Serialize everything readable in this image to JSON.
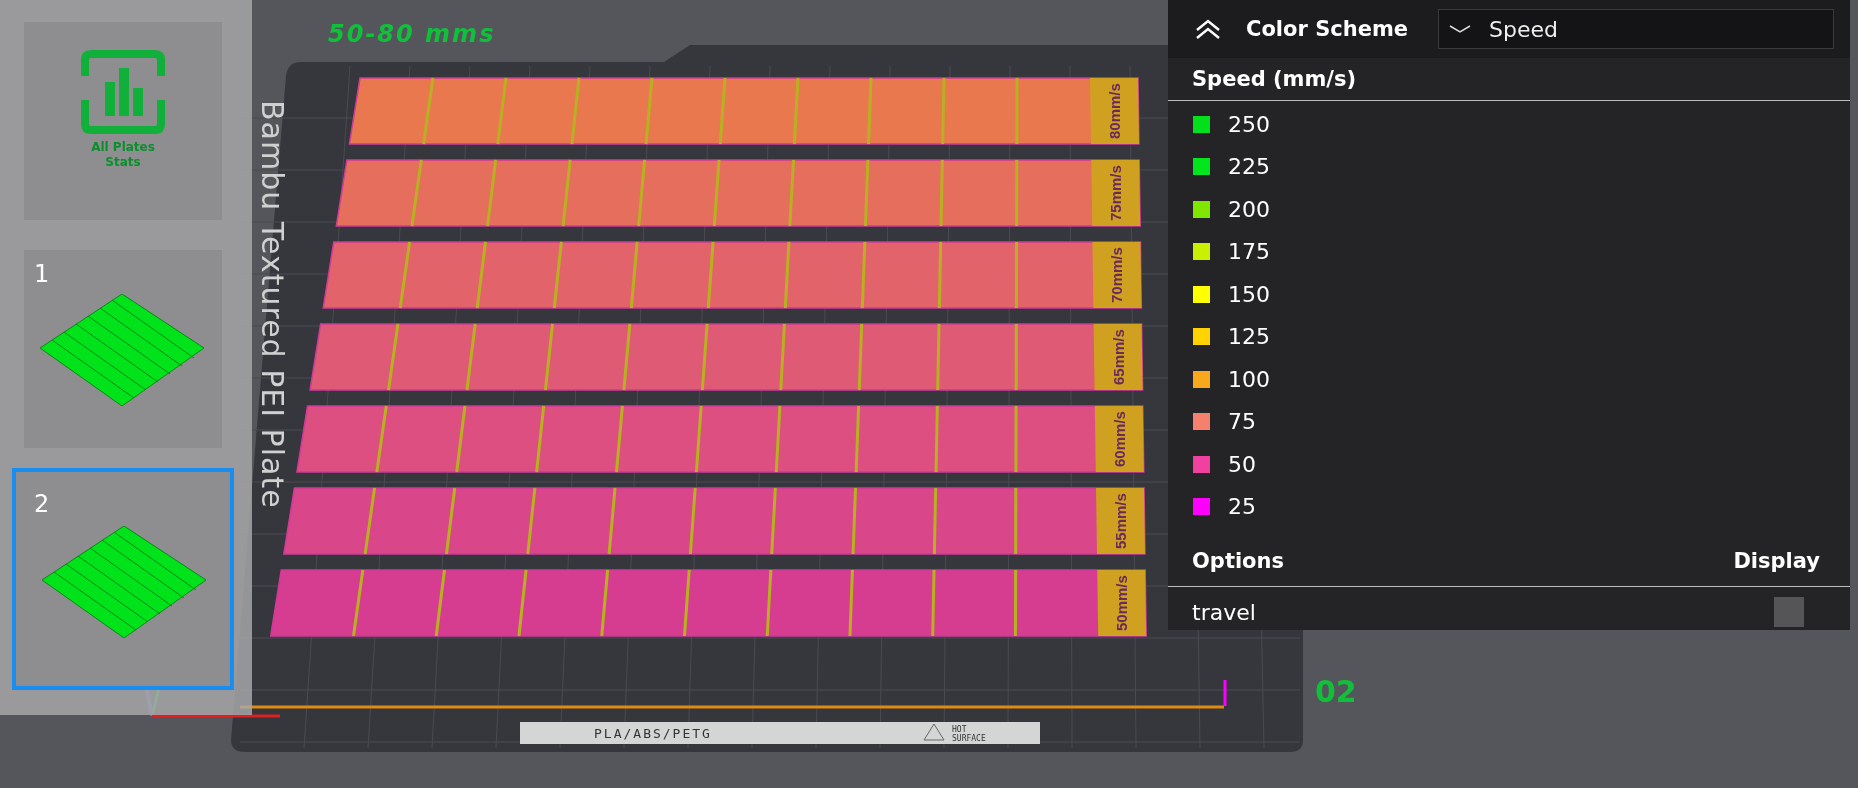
{
  "scene": {
    "title": "50-80 mms",
    "plate_name": "Bambu Textured PEI Plate",
    "plate_number": "02",
    "bed_label": "PLA/ABS/PETG",
    "warning_line_1": "HOT",
    "warning_line_2": "SURFACE",
    "rows": [
      {
        "label": "80mm/s",
        "color": "#e9784e"
      },
      {
        "label": "75mm/s",
        "color": "#e56e5c"
      },
      {
        "label": "70mm/s",
        "color": "#e2646a"
      },
      {
        "label": "65mm/s",
        "color": "#df5a74"
      },
      {
        "label": "60mm/s",
        "color": "#dc4f80"
      },
      {
        "label": "55mm/s",
        "color": "#d9468a"
      },
      {
        "label": "50mm/s",
        "color": "#d63d90"
      }
    ]
  },
  "sidebar": {
    "stats_label": "All Plates Stats",
    "plates": [
      {
        "label": "1",
        "selected": false
      },
      {
        "label": "2",
        "selected": true
      }
    ]
  },
  "panel": {
    "title": "Color Scheme",
    "scheme": "Speed",
    "legend_title": "Speed (mm/s)",
    "legend": [
      {
        "label": "250",
        "color": "#00e11b"
      },
      {
        "label": "225",
        "color": "#00e61c"
      },
      {
        "label": "200",
        "color": "#7fe600"
      },
      {
        "label": "175",
        "color": "#c8f000"
      },
      {
        "label": "150",
        "color": "#ffff00"
      },
      {
        "label": "125",
        "color": "#ffd200"
      },
      {
        "label": "100",
        "color": "#f7a81c"
      },
      {
        "label": "75",
        "color": "#f5806e"
      },
      {
        "label": "50",
        "color": "#f040a0"
      },
      {
        "label": "25",
        "color": "#ff00ff"
      }
    ],
    "options_header": "Options",
    "display_header": "Display",
    "options": [
      {
        "label": "travel",
        "checked": false
      }
    ]
  }
}
